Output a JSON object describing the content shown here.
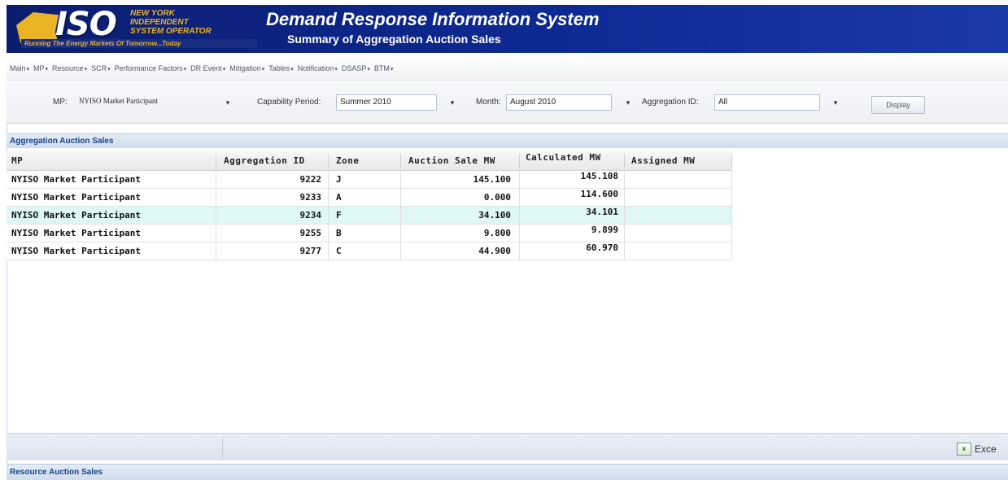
{
  "header": {
    "logo_text": "ISO",
    "logo_lines": [
      "NEW YORK",
      "INDEPENDENT",
      "SYSTEM OPERATOR"
    ],
    "tagline": "Running The Energy Markets Of Tomorrow...Today",
    "title": "Demand Response Information System",
    "subtitle": "Summary of Aggregation Auction Sales"
  },
  "menu": [
    {
      "label": "Main"
    },
    {
      "label": "MP"
    },
    {
      "label": "Resource"
    },
    {
      "label": "SCR"
    },
    {
      "label": "Performance Factors"
    },
    {
      "label": "DR Event"
    },
    {
      "label": "Mitigation"
    },
    {
      "label": "Tables"
    },
    {
      "label": "Notification"
    },
    {
      "label": "DSASP"
    },
    {
      "label": "BTM"
    }
  ],
  "filters": {
    "mp_label": "MP:",
    "mp_value": "NYISO Market Participant",
    "capability_label": "Capability Period:",
    "capability_value": "Summer 2010",
    "month_label": "Month:",
    "month_value": "August 2010",
    "aggregation_label": "Aggregation ID:",
    "aggregation_value": "All",
    "display_button": "Display"
  },
  "panel": {
    "title": "Aggregation Auction Sales",
    "columns": [
      "MP",
      "Aggregation ID",
      "Zone",
      "Auction Sale MW",
      "Calculated MW",
      "Assigned MW"
    ],
    "rows": [
      {
        "mp": "NYISO Market Participant",
        "aggregation_id": "9222",
        "zone": "J",
        "auction_sale_mw": "145.100",
        "calculated_mw": "145.108",
        "assigned_mw": ""
      },
      {
        "mp": "NYISO Market Participant",
        "aggregation_id": "9233",
        "zone": "A",
        "auction_sale_mw": "0.000",
        "calculated_mw": "114.600",
        "assigned_mw": ""
      },
      {
        "mp": "NYISO Market Participant",
        "aggregation_id": "9234",
        "zone": "F",
        "auction_sale_mw": "34.100",
        "calculated_mw": "34.101",
        "assigned_mw": ""
      },
      {
        "mp": "NYISO Market Participant",
        "aggregation_id": "9255",
        "zone": "B",
        "auction_sale_mw": "9.800",
        "calculated_mw": "9.899",
        "assigned_mw": ""
      },
      {
        "mp": "NYISO Market Participant",
        "aggregation_id": "9277",
        "zone": "C",
        "auction_sale_mw": "44.900",
        "calculated_mw": "60.970",
        "assigned_mw": ""
      }
    ],
    "selected_row": 2
  },
  "footer": {
    "excel_label": "Exce"
  },
  "panel2": {
    "title": "Resource Auction Sales"
  },
  "colors": {
    "banner": "#0d2a94",
    "logo_gold": "#e9b325",
    "panel_title": "#15428b",
    "selected_row": "#dff7f7"
  }
}
